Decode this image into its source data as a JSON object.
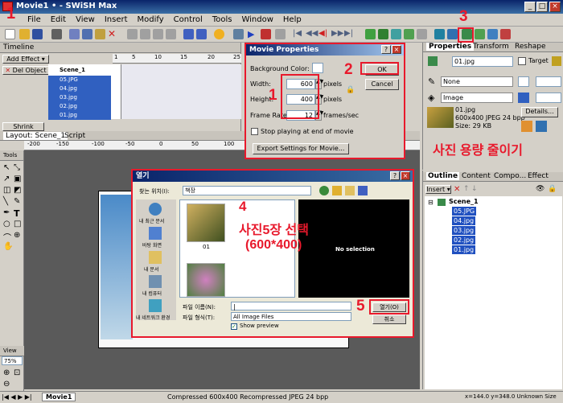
{
  "window": {
    "title": "Movie1 • - SWiSH Max",
    "min": "_",
    "max": "□",
    "close": "×"
  },
  "menu": [
    "File",
    "Edit",
    "View",
    "Insert",
    "Modify",
    "Control",
    "Tools",
    "Window",
    "Help"
  ],
  "annotations": {
    "n1": "1",
    "n2": "2",
    "n3": "3",
    "n4": "4",
    "n5": "5",
    "n1b": "1",
    "step4_line1": "사진5장 선택",
    "step4_line2": "(600*400)",
    "properties_note": "사진 용량 줄이기"
  },
  "timeline": {
    "tab": "Timeline",
    "add_effect": "Add Effect",
    "del_object": "Del Object",
    "shrink": "Shrink",
    "rows": [
      "Scene_1",
      "05.JPG",
      "04.jpg",
      "03.jpg",
      "02.jpg",
      "01.jpg"
    ],
    "ruler_marks": [
      "1",
      "5",
      "10",
      "15",
      "20",
      "25"
    ]
  },
  "layout": {
    "tab": "Layout: Scene_1",
    "script_tab": "Script",
    "ruler": [
      "-200",
      "-150",
      "-100",
      "-50",
      "0",
      "50",
      "100",
      "150",
      "200",
      "250"
    ]
  },
  "tools": {
    "label": "Tools",
    "view_label": "View",
    "zoom": "75%"
  },
  "movie_props": {
    "title": "Movie Properties",
    "bg_label": "Background Color:",
    "width_label": "Width:",
    "width_val": "600",
    "height_label": "Height:",
    "height_val": "400",
    "rate_label": "Frame Rate:",
    "rate_val": "12",
    "pixels": "pixels",
    "fps": "frames/sec",
    "stop_label": "Stop playing at end of movie",
    "export_btn": "Export Settings for Movie...",
    "ok": "OK",
    "cancel": "Cancel",
    "help": "?",
    "close": "×"
  },
  "open_dialog": {
    "title": "열기",
    "lookin_label": "찾는 위치(I):",
    "lookin_val": "책장",
    "places": [
      "내 최근 문서",
      "바탕 화면",
      "내 문서",
      "내 컴퓨터",
      "내 네트워크 환경"
    ],
    "file1": "01",
    "no_selection": "No selection",
    "filename_label": "파일 이름(N):",
    "filename_val": "|",
    "filetype_label": "파일 형식(T):",
    "filetype_val": "All Image Files",
    "show_preview": "Show preview",
    "open_btn": "열기(O)",
    "cancel_btn": "취소",
    "help": "?",
    "close": "×"
  },
  "properties": {
    "tabs": [
      "Properties",
      "Transform",
      "Reshape"
    ],
    "name": "01.jpg",
    "target": "Target",
    "line": "None",
    "fill": "Image",
    "info_name": "01.jpg",
    "info_dims": "600x400 JPEG 24 bpp",
    "info_size": "Size: 29 KB",
    "details": "Details..."
  },
  "outline": {
    "tabs": [
      "Outline",
      "Content",
      "Compo...",
      "Effect"
    ],
    "insert": "Insert",
    "scene": "Scene_1",
    "items": [
      "05.JPG",
      "04.jpg",
      "03.jpg",
      "02.jpg",
      "01.jpg"
    ]
  },
  "status": {
    "tab": "Movie1",
    "text": "Compressed 600x400 Recompressed JPEG 24 bpp",
    "coords": "x=144.0 y=348.0  Unknown Size"
  },
  "colors": {
    "red": "#e8192c",
    "selection": "#3060c0",
    "titlebar": "#0a246a",
    "chrome": "#d4d0c8"
  }
}
